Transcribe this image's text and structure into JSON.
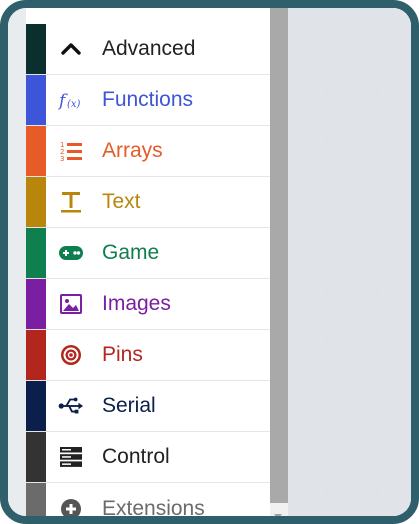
{
  "toolbox": {
    "categories": [
      {
        "label": "Advanced",
        "color": "#0b2f2c",
        "text_color": "#222222",
        "icon": "chevron-up-icon"
      },
      {
        "label": "Functions",
        "color": "#3d55d8",
        "text_color": "#3d55d8",
        "icon": "function-icon"
      },
      {
        "label": "Arrays",
        "color": "#e65b28",
        "text_color": "#e65b28",
        "icon": "ordered-list-icon"
      },
      {
        "label": "Text",
        "color": "#b8860b",
        "text_color": "#b8860b",
        "icon": "text-icon"
      },
      {
        "label": "Game",
        "color": "#0f7f4f",
        "text_color": "#0f7f4f",
        "icon": "gamepad-icon"
      },
      {
        "label": "Images",
        "color": "#7b1fa2",
        "text_color": "#7b1fa2",
        "icon": "image-icon"
      },
      {
        "label": "Pins",
        "color": "#b3261e",
        "text_color": "#b3261e",
        "icon": "target-icon"
      },
      {
        "label": "Serial",
        "color": "#0a1f4a",
        "text_color": "#0a1f4a",
        "icon": "usb-icon"
      },
      {
        "label": "Control",
        "color": "#333333",
        "text_color": "#222222",
        "icon": "server-icon"
      },
      {
        "label": "Extensions",
        "color": "#6b6b6b",
        "text_color": "#6b6b6b",
        "icon": "plus-circle-icon"
      }
    ]
  },
  "theme": {
    "frame": "#2f5f6b",
    "workspace": "#eef1f4",
    "scrollbar_thumb": "#a9a9a9"
  }
}
